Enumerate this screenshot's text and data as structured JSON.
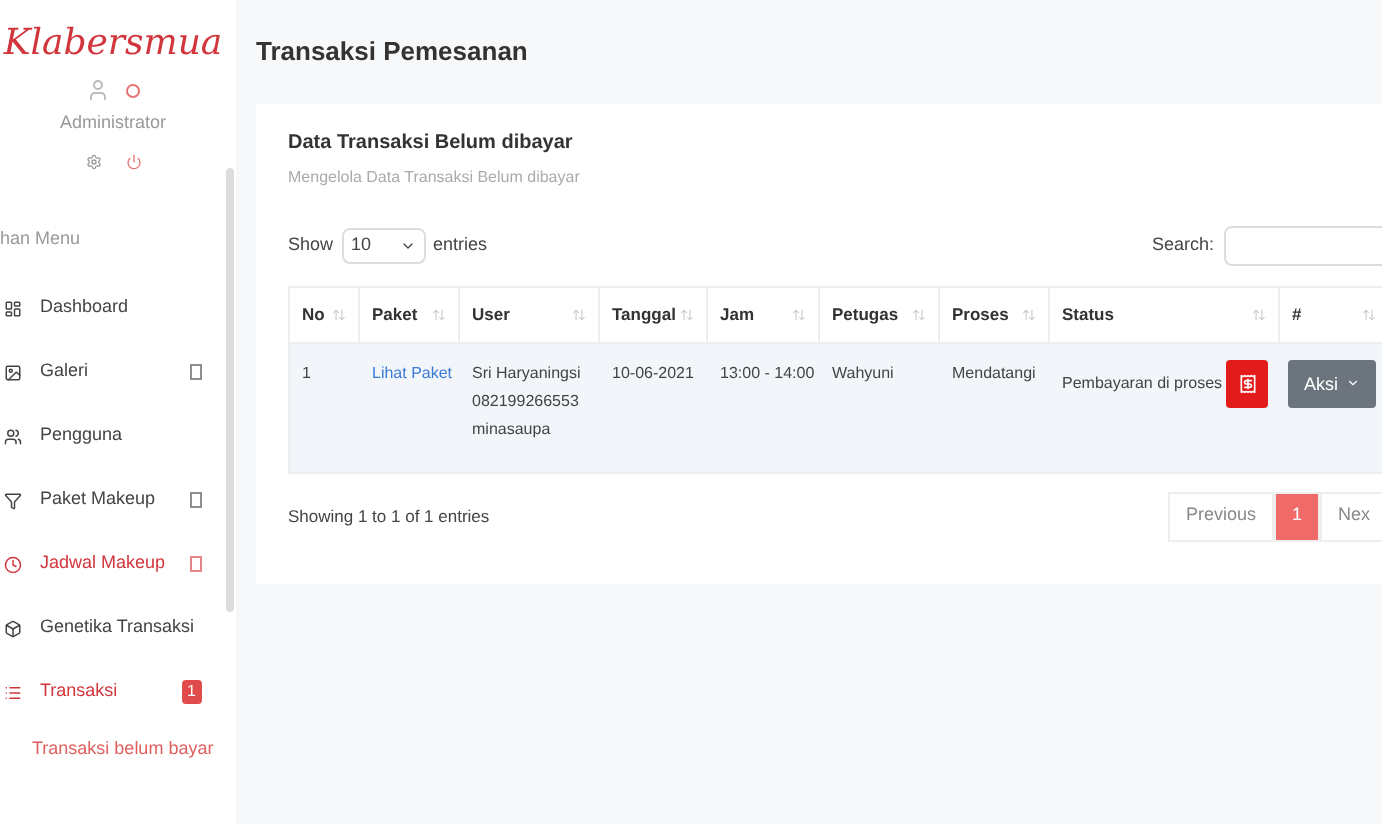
{
  "sidebar": {
    "logo": "Klabersmua",
    "user": {
      "name": "Administrator",
      "online": true
    },
    "section_label": "han Menu",
    "items": [
      {
        "label": "Dashboard",
        "highlighted": false,
        "submenu": false
      },
      {
        "label": "Galeri",
        "highlighted": false,
        "submenu": true
      },
      {
        "label": "Pengguna",
        "highlighted": false,
        "submenu": false
      },
      {
        "label": "Paket Makeup",
        "highlighted": false,
        "submenu": true
      },
      {
        "label": "Jadwal Makeup",
        "highlighted": true,
        "submenu": true
      },
      {
        "label": "Genetika Transaksi",
        "highlighted": false,
        "submenu": false
      },
      {
        "label": "Transaksi",
        "highlighted": true,
        "submenu": false,
        "badge": "1",
        "children": [
          {
            "label": "Transaksi belum bayar",
            "selected": true
          }
        ]
      }
    ]
  },
  "page_title": "Transaksi Pemesanan",
  "card": {
    "title": "Data Transaksi Belum dibayar",
    "subtitle": "Mengelola Data Transaksi Belum dibayar",
    "length": {
      "before": "Show",
      "value": "10",
      "after": "entries"
    },
    "search_label": "Search:",
    "table": {
      "columns": [
        "No",
        "Paket",
        "User",
        "Tanggal",
        "Jam",
        "Petugas",
        "Proses",
        "Status",
        "#"
      ],
      "rows": [
        {
          "no": "1",
          "paket": "Lihat Paket",
          "user": [
            "Sri Haryaningsi",
            "082199266553",
            "minasaupa"
          ],
          "tanggal": "10-06-2021",
          "jam": "13:00 - 14:00",
          "petugas": "Wahyuni",
          "proses": "Mendatangi",
          "status": "Pembayaran di proses",
          "action": "Aksi"
        }
      ]
    },
    "info": "Showing 1 to 1 of 1 entries",
    "pagination": [
      {
        "label": "Previous",
        "selected": false
      },
      {
        "label": "1",
        "selected": true
      },
      {
        "label": "Nex",
        "selected": false
      }
    ]
  }
}
